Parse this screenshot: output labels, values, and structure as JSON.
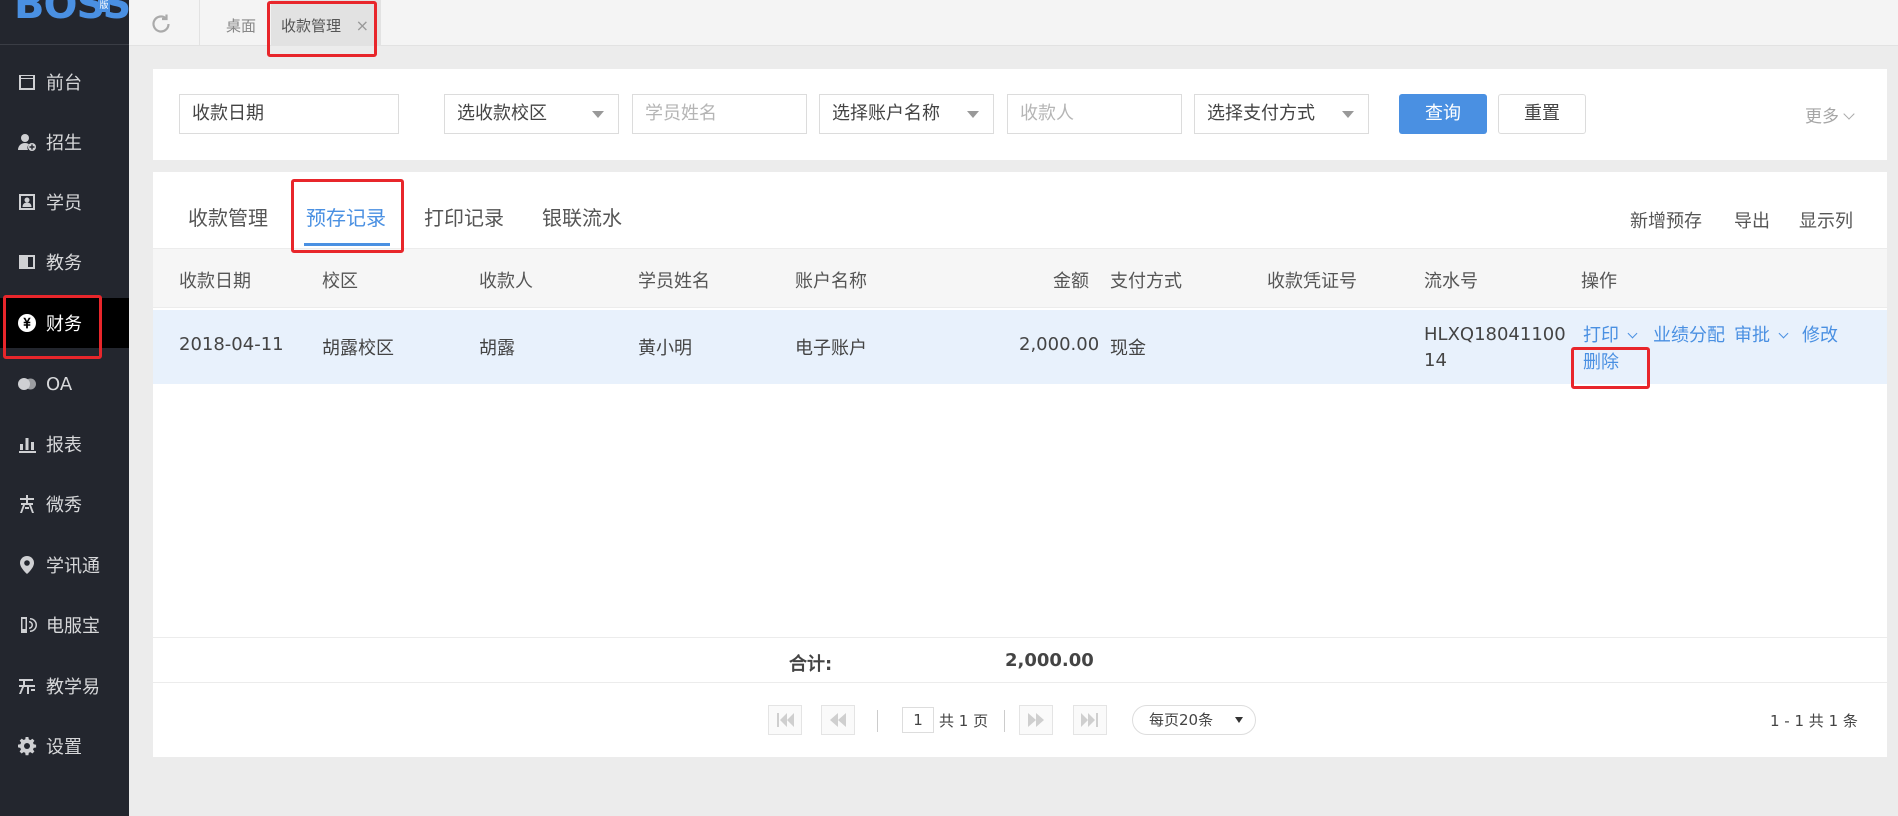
{
  "brand": {
    "logo_text": "BOSS",
    "logo_badge": "版"
  },
  "sidebar": {
    "items": [
      {
        "label": "前台",
        "icon": "calendar-icon"
      },
      {
        "label": "招生",
        "icon": "user-add-icon"
      },
      {
        "label": "学员",
        "icon": "student-card-icon"
      },
      {
        "label": "教务",
        "icon": "book-icon"
      },
      {
        "label": "财务",
        "icon": "yen-icon",
        "active": true
      },
      {
        "label": "OA",
        "icon": "chat-icon"
      },
      {
        "label": "报表",
        "icon": "bar-chart-icon"
      },
      {
        "label": "微秀",
        "icon": "xiu-icon"
      },
      {
        "label": "学讯通",
        "icon": "location-pin-icon"
      },
      {
        "label": "电服宝",
        "icon": "phone-icon"
      },
      {
        "label": "教学易",
        "icon": "teach-icon"
      },
      {
        "label": "设置",
        "icon": "gear-icon"
      }
    ]
  },
  "topbar": {
    "home_tab": "桌面",
    "current_tab": "收款管理",
    "close_glyph": "×"
  },
  "search": {
    "date_field": "收款日期",
    "campus_select": "选收款校区",
    "student_placeholder": "学员姓名",
    "account_select": "选择账户名称",
    "payee_placeholder": "收款人",
    "payment_select": "选择支付方式",
    "query_button": "查询",
    "reset_button": "重置",
    "more_link": "更多"
  },
  "tabs": [
    {
      "label": "收款管理"
    },
    {
      "label": "预存记录",
      "active": true
    },
    {
      "label": "打印记录"
    },
    {
      "label": "银联流水"
    }
  ],
  "actions": {
    "add_prestore": "新增预存",
    "export": "导出",
    "show_columns": "显示列"
  },
  "table": {
    "headers": {
      "date": "收款日期",
      "campus": "校区",
      "payee": "收款人",
      "student": "学员姓名",
      "account": "账户名称",
      "amount": "金额",
      "method": "支付方式",
      "voucher": "收款凭证号",
      "serial": "流水号",
      "ops": "操作"
    },
    "rows": [
      {
        "date": "2018-04-11",
        "campus": "胡露校区",
        "payee": "胡露",
        "student": "黄小明",
        "account": "电子账户",
        "amount": "2,000.00",
        "method": "现金",
        "voucher": "",
        "serial_line1": "HLXQ18041100",
        "serial_line2": "14",
        "op_print": "打印",
        "op_allocate": "业绩分配",
        "op_approve": "审批",
        "op_edit": "修改",
        "op_delete": "删除"
      }
    ],
    "summary_label": "合计:",
    "summary_value": "2,000.00"
  },
  "pagination": {
    "current_page": "1",
    "total_pages_text": "共 1 页",
    "page_size": "每页20条",
    "range_text": "1 - 1   共 1 条"
  },
  "colors": {
    "accent": "#4a90e2",
    "sidebar_bg": "#23262e",
    "highlight_red": "#e8262b",
    "row_selected": "#e8f1fc"
  }
}
